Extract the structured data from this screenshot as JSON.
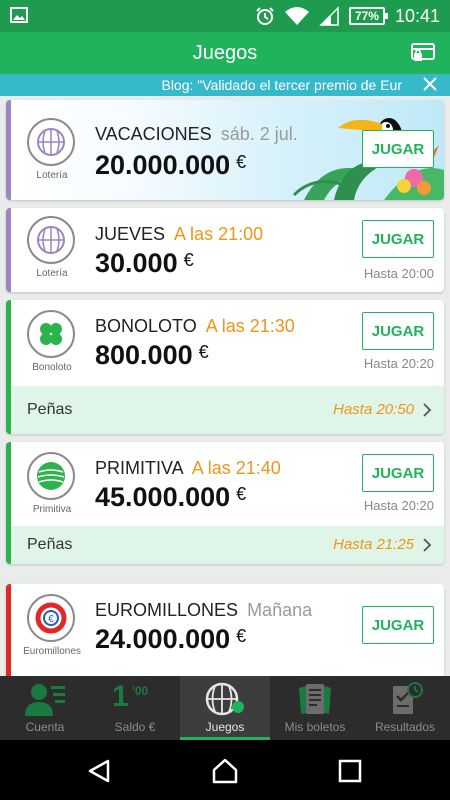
{
  "status_bar": {
    "battery": "77%",
    "time": "10:41"
  },
  "app_bar": {
    "title": "Juegos"
  },
  "ticker": {
    "text": "Blog: \"Validado el tercer premio de Eur"
  },
  "games": [
    {
      "logo_label": "Lotería",
      "name": "VACACIONES",
      "when": "sáb. 2 jul.",
      "amount": "20.000.000",
      "currency": "€",
      "button": "JUGAR"
    },
    {
      "logo_label": "Lotería",
      "name": "JUEVES",
      "when": "A las 21:00",
      "amount": "30.000",
      "currency": "€",
      "button": "JUGAR",
      "hasta": "Hasta 20:00"
    },
    {
      "logo_label": "Bonoloto",
      "name": "BONOLOTO",
      "when": "A las 21:30",
      "amount": "800.000",
      "currency": "€",
      "button": "JUGAR",
      "hasta": "Hasta 20:20",
      "penas_label": "Peñas",
      "penas_hasta": "Hasta 20:50"
    },
    {
      "logo_label": "Primitiva",
      "name": "PRIMITIVA",
      "when": "A las 21:40",
      "amount": "45.000.000",
      "currency": "€",
      "button": "JUGAR",
      "hasta": "Hasta 20:20",
      "penas_label": "Peñas",
      "penas_hasta": "Hasta 21:25"
    },
    {
      "logo_label": "Euromillones",
      "name": "EUROMILLONES",
      "when": "Mañana",
      "amount": "24.000.000",
      "currency": "€",
      "button": "JUGAR"
    }
  ],
  "bottom_nav": [
    {
      "label": "Cuenta",
      "icon": "account-icon"
    },
    {
      "label": "Saldo €",
      "icon": "balance-icon",
      "value_int": "1",
      "value_dec": "'00"
    },
    {
      "label": "Juegos",
      "icon": "lottery-ball-icon",
      "active": true
    },
    {
      "label": "Mis boletos",
      "icon": "tickets-icon"
    },
    {
      "label": "Resultados",
      "icon": "results-icon"
    }
  ],
  "colors": {
    "primary": "#21b35c",
    "status_bar": "#1e9b4f",
    "ticker": "#36b9c9",
    "accent_orange": "#f0951a",
    "loteria": "#9b85c2",
    "bonoloto": "#2db34e",
    "euromillones": "#e22727"
  }
}
